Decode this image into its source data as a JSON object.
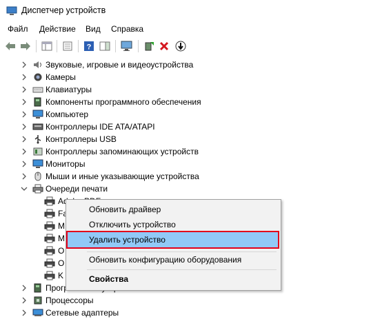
{
  "window": {
    "title": "Диспетчер устройств"
  },
  "menu": {
    "file": "Файл",
    "action": "Действие",
    "view": "Вид",
    "help": "Справка"
  },
  "tree": {
    "sound": "Звуковые, игровые и видеоустройства",
    "cameras": "Камеры",
    "keyboards": "Клавиатуры",
    "software": "Компоненты программного обеспечения",
    "computer": "Компьютер",
    "ide": "Контроллеры IDE ATA/ATAPI",
    "usb": "Контроллеры USB",
    "storage": "Контроллеры запоминающих устройств",
    "monitors": "Мониторы",
    "mice": "Мыши и иные указывающие устройства",
    "print_queues": "Очереди печати",
    "printers": [
      {
        "label": "Adobe PDF"
      },
      {
        "label": "Fa"
      },
      {
        "label": "M"
      },
      {
        "label": "M"
      },
      {
        "label": "O"
      },
      {
        "label": "O"
      },
      {
        "label": "K"
      }
    ],
    "software_devices": "Программные устройства",
    "processors": "Процессоры",
    "network": "Сетевые адаптеры"
  },
  "context_menu": {
    "update_driver": "Обновить драйвер",
    "disable": "Отключить устройство",
    "uninstall": "Удалить устройство",
    "scan": "Обновить конфигурацию оборудования",
    "properties": "Свойства"
  },
  "colors": {
    "selection": "#91c9f7",
    "highlight_frame": "#e2001a",
    "delete_icon": "#d4171f"
  }
}
